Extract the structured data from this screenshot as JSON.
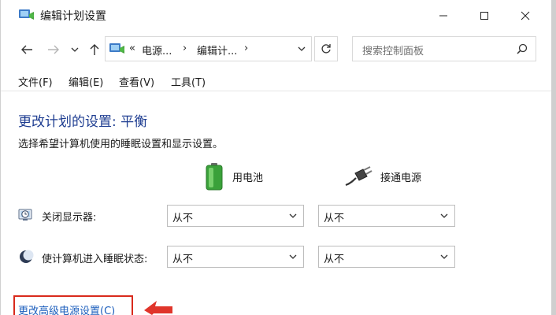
{
  "window": {
    "title": "编辑计划设置",
    "controls": {
      "minimize": "minimize",
      "maximize": "maximize",
      "close": "close"
    }
  },
  "nav": {
    "breadcrumb": {
      "prefix": "«",
      "item1": "电源...",
      "sep": "›",
      "item2": "编辑计...",
      "dropdown": "⌄"
    }
  },
  "search": {
    "placeholder": "搜索控制面板"
  },
  "menu": {
    "file": "文件(F)",
    "edit": "编辑(E)",
    "view": "查看(V)",
    "tools": "工具(T)"
  },
  "content": {
    "heading": "更改计划的设置: 平衡",
    "description": "选择希望计算机使用的睡眠设置和显示设置。",
    "columns": {
      "battery": "用电池",
      "plugged": "接通电源"
    },
    "rows": [
      {
        "label": "关闭显示器:",
        "battery_value": "从不",
        "plugged_value": "从不"
      },
      {
        "label": "使计算机进入睡眠状态:",
        "battery_value": "从不",
        "plugged_value": "从不"
      }
    ],
    "advanced_link": "更改高级电源设置(C)"
  },
  "colors": {
    "heading": "#1e3d91",
    "link": "#1d5fbd",
    "highlight": "#d92a1c"
  },
  "icons": {
    "app": "power-options-icon",
    "back": "back-arrow-icon",
    "forward": "forward-arrow-icon",
    "recent": "chevron-down-icon",
    "up": "up-arrow-icon",
    "refresh": "refresh-icon",
    "search": "search-icon",
    "battery": "battery-icon",
    "plug": "power-plug-icon",
    "display": "display-timer-icon",
    "sleep": "moon-icon"
  }
}
